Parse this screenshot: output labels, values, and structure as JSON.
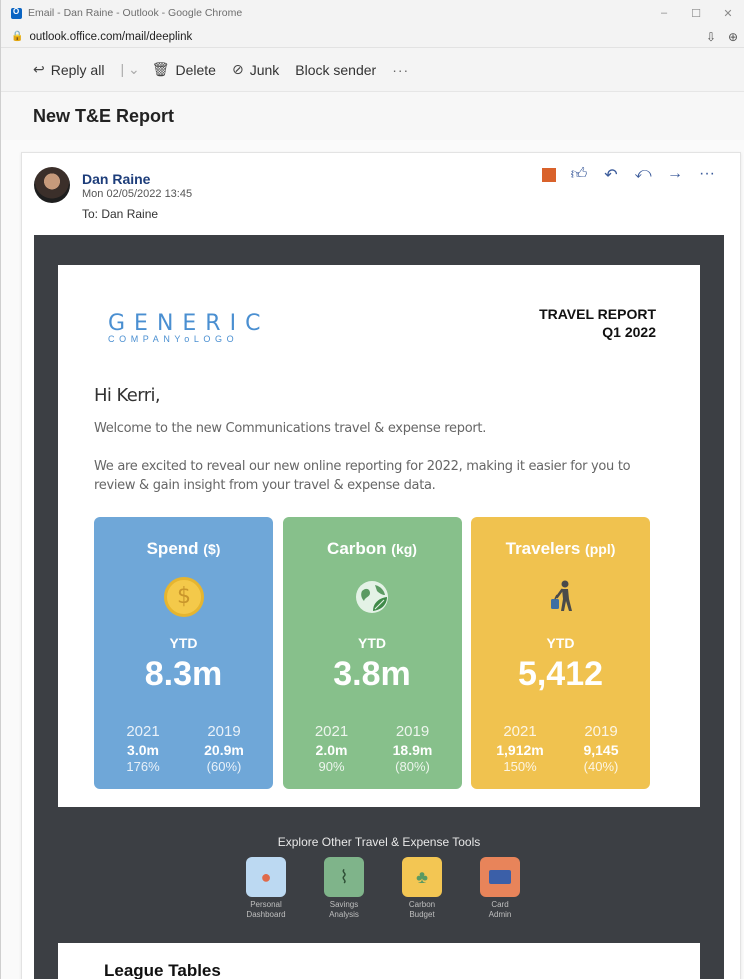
{
  "browser": {
    "title": "Email - Dan Raine - Outlook - Google Chrome",
    "url": "outlook.office.com/mail/deeplink",
    "controls": [
      "–",
      "☐",
      "✕"
    ]
  },
  "toolbar": {
    "reply_all": "Reply all",
    "delete": "Delete",
    "junk": "Junk",
    "block": "Block sender",
    "more": "···"
  },
  "subject": "New T&E Report",
  "message": {
    "sender": "Dan Raine",
    "date": "Mon 02/05/2022 13:45",
    "to": "To:  Dan Raine"
  },
  "email": {
    "logo_top": "GENERIC",
    "logo_bottom": "COMPANYoLOGO",
    "report_line1": "TRAVEL REPORT",
    "report_line2": "Q1 2022",
    "greeting": "Hi Kerri,",
    "intro": "Welcome to the new Communications travel & expense report.",
    "paragraph": "We are excited to reveal our new online reporting for 2022, making it easier for you to review & gain insight from your travel & expense data.",
    "tiles": [
      {
        "title": "Spend",
        "unit": "($)",
        "ytd": "YTD",
        "value": "8.3m",
        "y1": "2021",
        "v1": "3.0m",
        "p1": "176%",
        "y2": "2019",
        "v2": "20.9m",
        "p2": "(60%)"
      },
      {
        "title": "Carbon",
        "unit": "(kg)",
        "ytd": "YTD",
        "value": "3.8m",
        "y1": "2021",
        "v1": "2.0m",
        "p1": "90%",
        "y2": "2019",
        "v2": "18.9m",
        "p2": "(80%)"
      },
      {
        "title": "Travelers",
        "unit": "(ppl)",
        "ytd": "YTD",
        "value": "5,412",
        "y1": "2021",
        "v1": "1,912m",
        "p1": "150%",
        "y2": "2019",
        "v2": "9,145",
        "p2": "(40%)"
      }
    ],
    "tools_title": "Explore Other Travel & Expense Tools",
    "tools": [
      {
        "line1": "Personal",
        "line2": "Dashboard",
        "color": "#bcd9f2"
      },
      {
        "line1": "Savings",
        "line2": "Analysis",
        "color": "#7fb48a"
      },
      {
        "line1": "Carbon",
        "line2": "Budget",
        "color": "#f3c653"
      },
      {
        "line1": "Card",
        "line2": "Admin",
        "color": "#e8845a"
      }
    ],
    "league_title": "League Tables"
  },
  "colors": {
    "spend": "#6fa7d8",
    "carbon": "#87c08b",
    "travelers": "#f0c24f",
    "frame": "#3c3f44",
    "sender": "#1d3d7a"
  }
}
